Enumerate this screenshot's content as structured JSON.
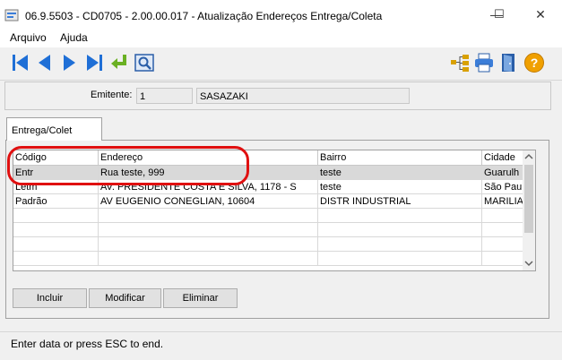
{
  "window": {
    "title": "06.9.5503 - CD0705 - 2.00.00.017 - Atualização Endereços Entrega/Coleta",
    "minimize": "—",
    "maximize": "☐",
    "close": "✕"
  },
  "menu": {
    "items": [
      {
        "label": "Arquivo"
      },
      {
        "label": "Ajuda"
      }
    ]
  },
  "toolbar": {
    "nav_icons": [
      "first-record-icon",
      "previous-record-icon",
      "next-record-icon",
      "last-record-icon",
      "confirm-return-icon",
      "zoom-search-icon"
    ],
    "tool_icons": [
      "hierarchy-icon",
      "printer-icon",
      "exit-door-icon",
      "help-icon"
    ]
  },
  "emitente": {
    "label": "Emitente:",
    "code": "1",
    "name": "SASAZAKI"
  },
  "tab": {
    "label": "Entrega/Colet"
  },
  "grid": {
    "headers": [
      "Código",
      "Endereço",
      "Bairro",
      "Cidade"
    ],
    "rows": [
      [
        "Entr",
        "Rua teste, 999",
        "teste",
        "Guarulh"
      ],
      [
        "Letm",
        "AV. PRESIDENTE COSTA E SILVA, 1178 - S",
        "teste",
        "São Pau"
      ],
      [
        "Padrão",
        "AV EUGENIO CONEGLIAN, 10604",
        "DISTR INDUSTRIAL",
        "MARILIA"
      ]
    ],
    "selected_row": 0
  },
  "buttons": {
    "add": "Incluir",
    "modify": "Modificar",
    "delete": "Eliminar"
  },
  "status": {
    "text": "Enter data or press ESC to end."
  },
  "colors": {
    "annotation": "#e01010",
    "nav_blue": "#1f6fd6",
    "help_orange": "#f0a000"
  }
}
